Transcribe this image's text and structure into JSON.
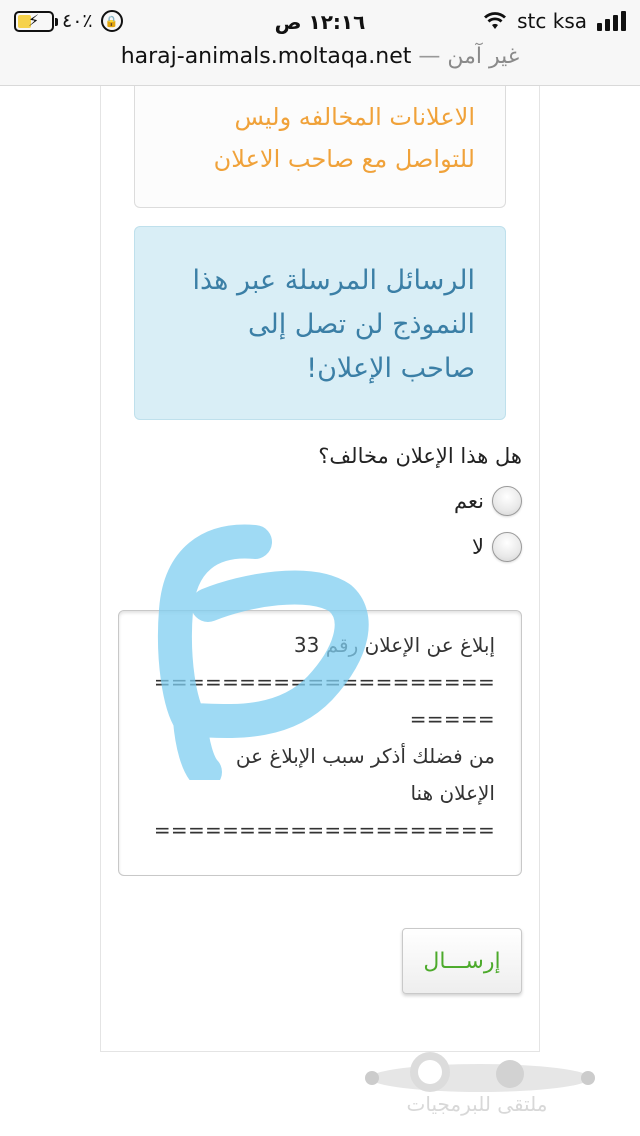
{
  "status_bar": {
    "battery": "٤٠٪",
    "time": "١٢:١٦ ص",
    "carrier": "stc ksa"
  },
  "url_bar": {
    "domain": "haraj-animals.moltaqa.net",
    "separator": "—",
    "security_label": "غير آمن"
  },
  "notices": {
    "warning_lines": [
      "الاعلانات المخالفه وليس",
      "للتواصل مع صاحب الاعلان"
    ],
    "info_lines": [
      "الرسائل المرسلة عبر هذا",
      "النموذج لن تصل إلى",
      "صاحب الإعلان!"
    ]
  },
  "form": {
    "question": "هل هذا الإعلان مخالف؟",
    "options": [
      {
        "label": "نعم",
        "selected": false
      },
      {
        "label": "لا",
        "selected": false
      }
    ],
    "message_lines": [
      "إبلاغ عن الإعلان رقم 33",
      "====================",
      "=====",
      "من فضلك أذكر سبب الإبلاغ عن",
      "الإعلان هنا",
      "===================="
    ],
    "submit_label": "إرســـال"
  },
  "watermark": {
    "text": "ملتقى للبرمجيات"
  },
  "colors": {
    "warning_text": "#f0a23a",
    "info_bg": "#d9eef6",
    "info_text": "#3b7fa6",
    "submit_text": "#4caa2b",
    "scribble": "#7fcdf0"
  }
}
